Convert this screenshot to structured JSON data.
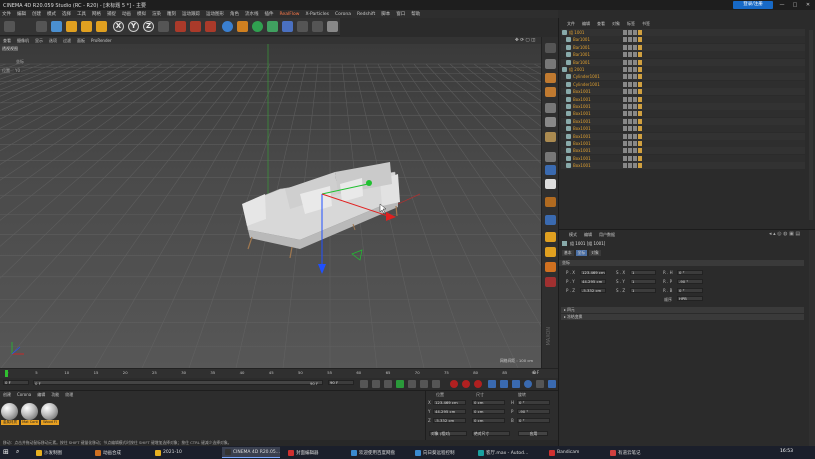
{
  "window": {
    "title": "CINEMA 4D R20.059 Studio (RC - R20) - [未标题 5 *] - 主要",
    "sign_in": "登录/注册"
  },
  "menu": [
    "文件",
    "编辑",
    "创建",
    "模式",
    "选择",
    "工具",
    "网格",
    "捕捉",
    "动画",
    "模拟",
    "渲染",
    "雕刻",
    "运动跟踪",
    "运动图形",
    "角色",
    "流水线",
    "插件",
    "RealFlow",
    "X-Particles",
    "Corona",
    "Redshift",
    "脚本",
    "窗口",
    "帮助"
  ],
  "menu_highlight": "RealFlow",
  "toolbar": {
    "axis_x": "X",
    "axis_y": "Y",
    "axis_z": "Z"
  },
  "viewport": {
    "menu": [
      "查看",
      "摄像机",
      "显示",
      "选项",
      "过滤",
      "面板",
      "ProRender"
    ],
    "label": "透视视图",
    "grid_spacing": "网格间距 : 100 cm",
    "side_label1": "坐标",
    "side_label2": "位置",
    "side_value": "Y0"
  },
  "timeline": {
    "ticks": [
      "0",
      "5",
      "10",
      "15",
      "20",
      "25",
      "30",
      "35",
      "40",
      "45",
      "50",
      "55",
      "60",
      "65",
      "70",
      "75",
      "80",
      "85",
      "90"
    ],
    "frame_end": "0 F",
    "current": "0 F",
    "start": "0 F",
    "end_a": "90 F",
    "end_b": "90 F"
  },
  "materials": {
    "menu": [
      "创建",
      "Corona",
      "编辑",
      "功能",
      "纹理"
    ],
    "items": [
      "金属材质",
      "Mat Cont",
      "Wood Fl"
    ]
  },
  "coordinates": {
    "headers": [
      "位置",
      "尺寸",
      "旋转"
    ],
    "rows": [
      {
        "axis": "X",
        "pos": "123.469 cm",
        "size": "0 cm",
        "rot_axis": "H",
        "rot": "0 °"
      },
      {
        "axis": "Y",
        "pos": "44.295 cm",
        "size": "0 cm",
        "rot_axis": "P",
        "rot": "-90 °"
      },
      {
        "axis": "Z",
        "pos": "-5.332 cm",
        "size": "0 cm",
        "rot_axis": "B",
        "rot": "0 °"
      }
    ],
    "mode": "对象 (相对)",
    "size_mode": "绝对尺寸",
    "apply": "应用"
  },
  "status": "移动：点击并拖动鼠标移动元素。按住 SHIFT 键量化移动；节点编辑模式时按住 SHIFT 键增加选择对象；按住 CTRL 键减少选择对象。",
  "object_manager": {
    "menu": [
      "文件",
      "编辑",
      "查看",
      "对象",
      "标签",
      "书签"
    ],
    "objects": [
      "组 1001",
      "Bar1001",
      "Bar1001",
      "Bar1001",
      "Bar1001",
      "组 2001",
      "Cylinder1001",
      "Cylinder1001",
      "Box1001",
      "Box1001",
      "Box1001",
      "Box1001",
      "Box1001",
      "Box1001",
      "Box1001",
      "Box1001",
      "Box1001",
      "Box1001",
      "Box1001"
    ]
  },
  "attributes": {
    "menu": [
      "模式",
      "编辑",
      "用户数据"
    ],
    "object_label": "组 1001 [组 1001]",
    "tabs": [
      "基本",
      "坐标",
      "对象"
    ],
    "section": "坐标",
    "rows": [
      {
        "p": "P . X",
        "pv": "123.469 cm",
        "s": "S . X",
        "sv": "1",
        "r": "R . H",
        "rv": "0 °"
      },
      {
        "p": "P . Y",
        "pv": "44.295 cm",
        "s": "S . Y",
        "sv": "1",
        "r": "R . P",
        "rv": "-90 °"
      },
      {
        "p": "P . Z",
        "pv": "-5.332 cm",
        "s": "S . Z",
        "sv": "1",
        "r": "R . B",
        "rv": "0 °"
      }
    ],
    "order_label": "顺序",
    "order_value": "HPB",
    "collapsed1": "▸ 四元",
    "collapsed2": "▸ 冻结变换"
  },
  "taskbar": {
    "items": [
      "沙发制图",
      "动画合成",
      "2021-10",
      "CINEMA 4D R20.05...",
      "封面编辑器",
      "欢迎使用百度网盘",
      "向日葵远程控制",
      "客厅.max - Autod...",
      "Bandicam",
      "有道云笔记"
    ],
    "time": "16:53"
  },
  "colors": {
    "accent_orange": "#e8a020",
    "axis_x": "#e02020",
    "axis_y": "#20c030",
    "axis_z": "#2050ff"
  }
}
